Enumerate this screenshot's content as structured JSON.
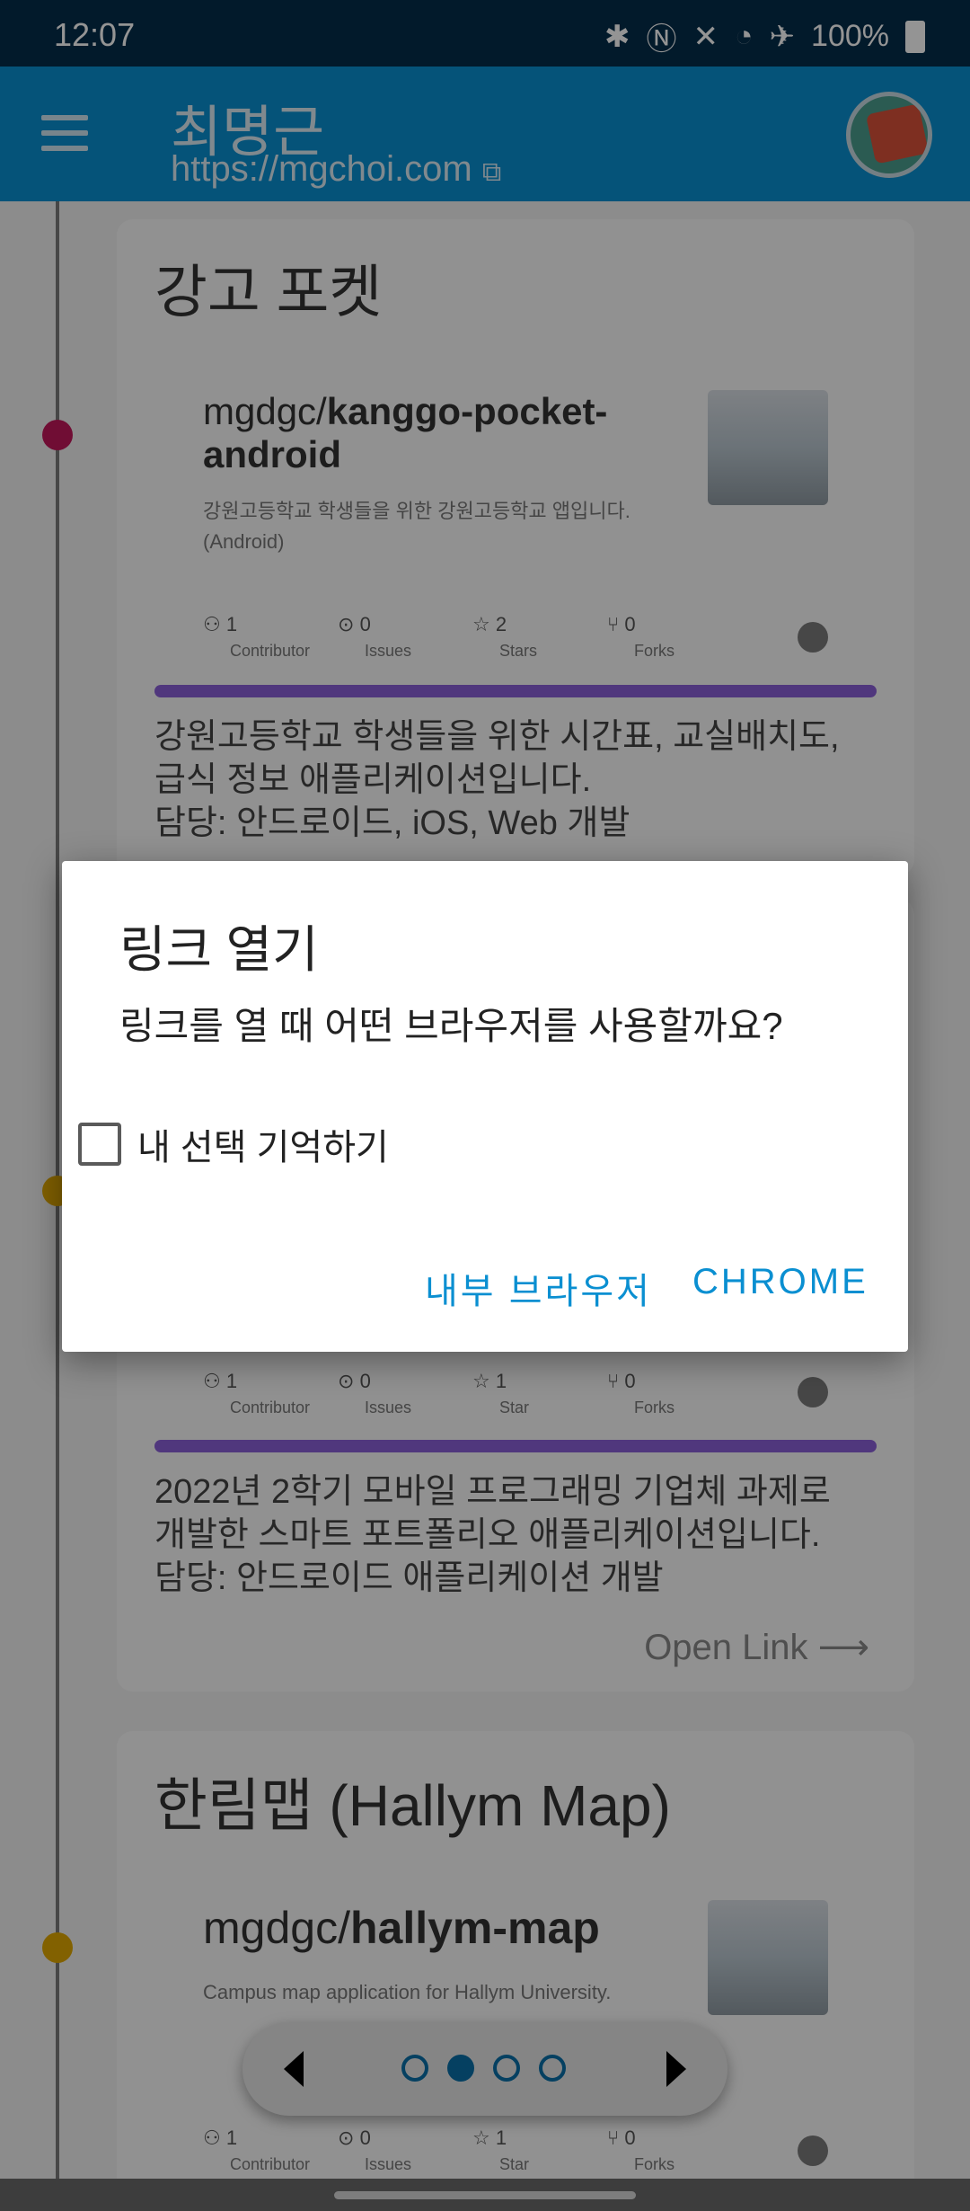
{
  "status_bar": {
    "time": "12:07",
    "battery": "100%",
    "icons": [
      "bluetooth-icon",
      "nfc-icon",
      "mute-vibrate-icon",
      "wifi-icon",
      "airplane-icon",
      "battery-icon"
    ]
  },
  "app_bar": {
    "title": "최명근",
    "url": "https://mgchoi.com"
  },
  "cards": [
    {
      "title": "강고 포켓",
      "repo_owner": "mgdgc/",
      "repo_name_line1": "kanggo-pocket-",
      "repo_name_line2": "android",
      "repo_desc_line1": "강원고등학교 학생들을 위한 강원고등학교 앱입니다.",
      "repo_desc_line2": "(Android)",
      "stats": [
        {
          "value": "1",
          "label": "Contributor"
        },
        {
          "value": "0",
          "label": "Issues"
        },
        {
          "value": "2",
          "label": "Stars"
        },
        {
          "value": "0",
          "label": "Forks"
        }
      ],
      "desc_lines": [
        "강원고등학교 학생들을 위한 시간표, 교실배치도,",
        "급식 정보 애플리케이션입니다.",
        "담당: 안드로이드, iOS, Web 개발"
      ]
    },
    {
      "stats": [
        {
          "value": "1",
          "label": "Contributor"
        },
        {
          "value": "0",
          "label": "Issues"
        },
        {
          "value": "1",
          "label": "Star"
        },
        {
          "value": "0",
          "label": "Forks"
        }
      ],
      "desc_lines": [
        "2022년 2학기 모바일 프로그래밍 기업체 과제로",
        "개발한 스마트 포트폴리오 애플리케이션입니다.",
        "담당: 안드로이드 애플리케이션 개발"
      ],
      "open_link": "Open Link ⟶"
    },
    {
      "title": "한림맵 (Hallym Map)",
      "repo_owner": "mgdgc/",
      "repo_name": "hallym-map",
      "repo_desc": "Campus map application for Hallym University.",
      "stats": [
        {
          "value": "1",
          "label": "Contributor"
        },
        {
          "value": "0",
          "label": "Issues"
        },
        {
          "value": "1",
          "label": "Star"
        },
        {
          "value": "0",
          "label": "Forks"
        }
      ]
    }
  ],
  "dialog": {
    "title": "링크 열기",
    "message": "링크를 열 때 어떤 브라우저를 사용할까요?",
    "checkbox_label": "내 선택 기억하기",
    "checkbox_checked": false,
    "btn_internal": "내부 브라우저",
    "btn_chrome": "CHROME"
  },
  "pager": {
    "active_index": 1
  },
  "colors": {
    "status_bar": "#052d4a",
    "app_bar": "#0a8fd1",
    "accent": "#0a8fd1",
    "language_bar": "#8b5fd8",
    "timeline_dot_1": "#c2185b",
    "timeline_dot_2": "#e0a800",
    "timeline_dot_3": "#e0a800"
  }
}
